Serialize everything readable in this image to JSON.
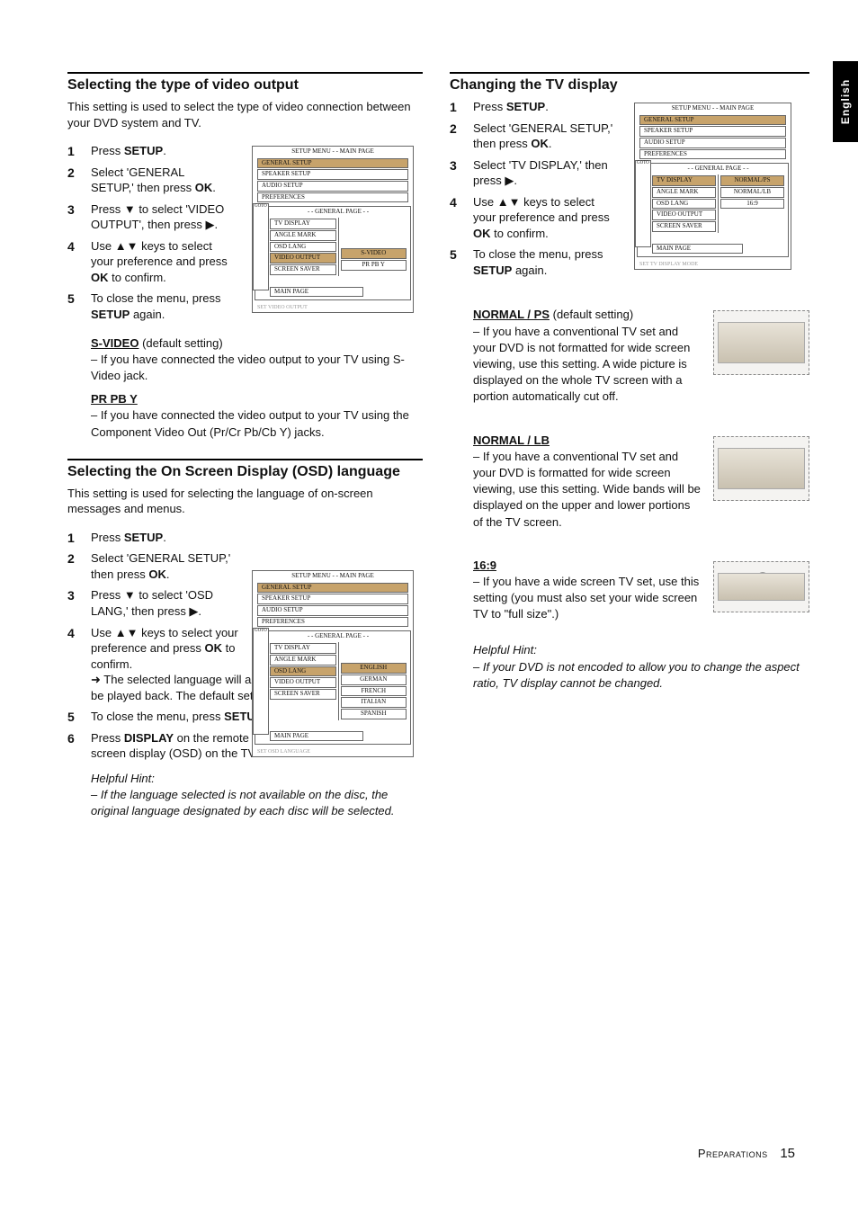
{
  "side_tab": "English",
  "footer": {
    "label": "Preparations",
    "page": "15"
  },
  "left": {
    "sec1": {
      "title": "Selecting the type of video output",
      "intro": "This setting is used to select the type of video connection between your DVD system and TV.",
      "steps": {
        "s1a": "Press ",
        "s1b": "SETUP",
        "s1c": ".",
        "s2a": "Select '",
        "s2b": "GENERAL SETUP",
        "s2c": ",' then press ",
        "s2d": "OK",
        "s2e": ".",
        "s3a": "Press ▼ to select '",
        "s3b": "VIDEO OUTPUT",
        "s3c": "', then press ▶.",
        "s4a": "Use ▲▼ keys to select your preference and press ",
        "s4b": "OK",
        "s4c": " to confirm.",
        "s5a": "To close the menu, press ",
        "s5b": "SETUP",
        "s5c": " again."
      },
      "sub1": {
        "title": "S-VIDEO",
        "note": " (default setting)",
        "body": "–   If you have connected the video output to your TV using S-Video jack."
      },
      "sub2": {
        "title": "PR PB Y",
        "body": "–   If  you have connected the video output to your TV using the Component Video Out (Pr/Cr Pb/Cb Y) jacks."
      }
    },
    "sec2": {
      "title": "Selecting the On Screen Display (OSD) language",
      "intro": "This setting is used for selecting the language of on-screen messages and menus.",
      "steps": {
        "s1a": "Press ",
        "s1b": "SETUP",
        "s1c": ".",
        "s2a": "Select '",
        "s2b": "GENERAL SETUP",
        "s2c": ",' then press ",
        "s2d": "OK",
        "s2e": ".",
        "s3a": "Press ▼ to select '",
        "s3b": "OSD LANG",
        "s3c": ",' then press ▶.",
        "s4a": "Use ▲▼ keys to select your preference and press ",
        "s4b": "OK",
        "s4c": " to confirm.",
        "s4d": "➜ The selected language will always be used for every disc to be played back.  The default setting is 'ENGLISH.'",
        "s5a": "To close the menu, press ",
        "s5b": "SETUP",
        "s5c": " again.",
        "s6a": "Press ",
        "s6b": "DISPLAY",
        "s6c": " on the remote control to switch on/off the on screen display (OSD) on the TV."
      },
      "hint_lbl": "Helpful Hint:",
      "hint": "–   If the language selected is not available on the disc, the original language designated by each disc will be selected."
    }
  },
  "right": {
    "sec1": {
      "title": "Changing the TV display",
      "steps": {
        "s1a": "Press ",
        "s1b": "SETUP",
        "s1c": ".",
        "s2a": "Select '",
        "s2b": "GENERAL SETUP",
        "s2c": ",' then press ",
        "s2d": "OK",
        "s2e": ".",
        "s3a": "Select '",
        "s3b": "TV DISPLAY",
        "s3c": ",' then press ▶.",
        "s4a": "Use ▲▼ keys to select your preference and press ",
        "s4b": "OK",
        "s4c": " to confirm.",
        "s5a": "To close the menu, press ",
        "s5b": "SETUP",
        "s5c": " again."
      },
      "n1": {
        "title": "NORMAL / PS",
        "note": " (default setting)",
        "body": "–   If you have a conventional TV set and your DVD is not formatted for wide screen viewing, use this setting. A wide picture is displayed on the whole TV screen with a portion automatically cut off."
      },
      "n2": {
        "title": "NORMAL / LB",
        "body": "–   If you have a conventional TV set and your DVD is formatted for wide screen viewing, use this setting.  Wide bands will be displayed on the upper and lower portions of the TV screen."
      },
      "n3": {
        "title": "16:9",
        "body": "–   If you have a wide screen TV set, use this setting (you must also set your wide screen TV to \"full size\".)"
      },
      "hint_lbl": "Helpful Hint:",
      "hint": "–   If your DVD is not encoded to allow you to change the aspect ratio, TV display cannot be changed."
    }
  },
  "osd1": {
    "title": "SETUP MENU - - MAIN PAGE",
    "menu": [
      "GENERAL SETUP",
      "SPEAKER SETUP",
      "AUDIO SETUP",
      "PREFERENCES"
    ],
    "subtitle": "- - GENERAL PAGE - -",
    "items": [
      "TV DISPLAY",
      "ANGLE MARK",
      "OSD LANG",
      "VIDEO OUTPUT",
      "SCREEN SAVER"
    ],
    "opts": [
      "S-VIDEO",
      "PR PB Y"
    ],
    "main": "MAIN PAGE",
    "caption": "SET VIDEO OUTPUT",
    "hl_item": 3,
    "hl_opt": 0
  },
  "osd2": {
    "title": "SETUP MENU - - MAIN PAGE",
    "menu": [
      "GENERAL SETUP",
      "SPEAKER SETUP",
      "AUDIO SETUP",
      "PREFERENCES"
    ],
    "subtitle": "- - GENERAL PAGE - -",
    "items": [
      "TV DISPLAY",
      "ANGLE MARK",
      "OSD LANG",
      "VIDEO OUTPUT",
      "SCREEN SAVER"
    ],
    "opts": [
      "ENGLISH",
      "GERMAN",
      "FRENCH",
      "ITALIAN",
      "SPANISH"
    ],
    "main": "MAIN PAGE",
    "caption": "SET OSD LANGUAGE",
    "hl_item": 2,
    "hl_opt": 0
  },
  "osd3": {
    "title": "SETUP MENU - - MAIN PAGE",
    "menu": [
      "GENERAL SETUP",
      "SPEAKER SETUP",
      "AUDIO SETUP",
      "PREFERENCES"
    ],
    "subtitle": "- - GENERAL PAGE - -",
    "items": [
      "TV DISPLAY",
      "ANGLE MARK",
      "OSD LANG",
      "VIDEO OUTPUT",
      "SCREEN SAVER"
    ],
    "opts": [
      "NORMAL/PS",
      "NORMAL/LB",
      "16:9"
    ],
    "main": "MAIN PAGE",
    "caption": "SET TV DISPLAY MODE",
    "hl_item": 0,
    "hl_opt": 0
  }
}
